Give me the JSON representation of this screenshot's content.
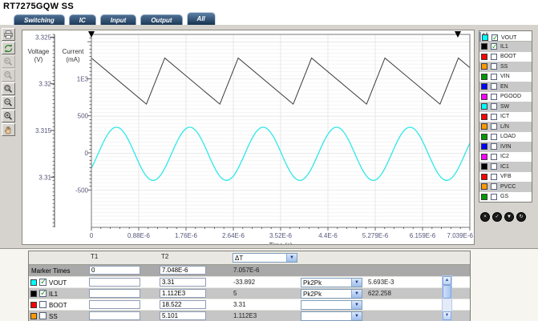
{
  "title": "RT7275GQW SS",
  "tabs": [
    {
      "label": "Switching",
      "active": false
    },
    {
      "label": "IC",
      "active": false
    },
    {
      "label": "Input",
      "active": false
    },
    {
      "label": "Output",
      "active": false
    },
    {
      "label": "All",
      "active": true
    }
  ],
  "toolbar": [
    {
      "name": "print-button",
      "icon": "print-icon",
      "disabled": false
    },
    {
      "name": "refresh-button",
      "icon": "refresh-icon",
      "disabled": false
    },
    {
      "name": "zoom-previous-button",
      "icon": "zoom-previous-icon",
      "disabled": true
    },
    {
      "name": "zoom-undo-button",
      "icon": "zoom-undo-icon",
      "disabled": true
    },
    {
      "name": "zoom-window-button",
      "icon": "zoom-window-icon",
      "disabled": false
    },
    {
      "name": "zoom-out-button",
      "icon": "zoom-out-icon",
      "disabled": false
    },
    {
      "name": "zoom-in-button",
      "icon": "zoom-in-icon",
      "disabled": false
    },
    {
      "name": "pan-button",
      "icon": "pan-hand-icon",
      "disabled": false
    }
  ],
  "legend": {
    "header": "All",
    "items": [
      {
        "label": "VOUT",
        "color": "#00FFFF",
        "checked": true,
        "selected": true
      },
      {
        "label": "IL1",
        "color": "#000000",
        "checked": true,
        "selected": false
      },
      {
        "label": "BOOT",
        "color": "#FF0000",
        "checked": false,
        "selected": false
      },
      {
        "label": "SS",
        "color": "#FF9900",
        "checked": false,
        "selected": false
      },
      {
        "label": "VIN",
        "color": "#009900",
        "checked": false,
        "selected": false
      },
      {
        "label": "EN",
        "color": "#0000FF",
        "checked": false,
        "selected": false
      },
      {
        "label": "PGOOD",
        "color": "#FF00FF",
        "checked": false,
        "selected": false
      },
      {
        "label": "SW",
        "color": "#00FFFF",
        "checked": false,
        "selected": false
      },
      {
        "label": "ICT",
        "color": "#FF0000",
        "checked": false,
        "selected": false
      },
      {
        "label": "L/N",
        "color": "#FF9900",
        "checked": false,
        "selected": false
      },
      {
        "label": "LOAD",
        "color": "#009900",
        "checked": false,
        "selected": false
      },
      {
        "label": "IVIN",
        "color": "#0000FF",
        "checked": false,
        "selected": false
      },
      {
        "label": "IC2",
        "color": "#FF00FF",
        "checked": false,
        "selected": false
      },
      {
        "label": "IC1",
        "color": "#000000",
        "checked": false,
        "selected": false
      },
      {
        "label": "VFB",
        "color": "#FF0000",
        "checked": false,
        "selected": false
      },
      {
        "label": "PVCC",
        "color": "#FF9900",
        "checked": false,
        "selected": false
      },
      {
        "label": "GS",
        "color": "#009900",
        "checked": false,
        "selected": false
      }
    ],
    "buttons": [
      {
        "name": "legend-close-button",
        "icon": "circle-x-icon"
      },
      {
        "name": "legend-check-button",
        "icon": "circle-check-icon"
      },
      {
        "name": "legend-scroll-down-button",
        "icon": "circle-chevron-down-icon"
      },
      {
        "name": "legend-refresh-button",
        "icon": "circle-redo-icon"
      }
    ]
  },
  "table": {
    "header": {
      "t1": "T1",
      "t2": "T2",
      "delta_select": "ΔT"
    },
    "marker_row": {
      "label": "Marker Times",
      "t1": "0",
      "t2": "7.048E-6",
      "delta": "7.057E-6"
    },
    "rows": [
      {
        "name": "VOUT",
        "color": "#00FFFF",
        "checked": true,
        "t1": "",
        "t2": "3.31",
        "delta": "-33.892",
        "func": "Pk2Pk",
        "result": "5.693E-3"
      },
      {
        "name": "IL1",
        "color": "#000000",
        "checked": true,
        "t1": "",
        "t2": "1.112E3",
        "delta": "5",
        "func": "Pk2Pk",
        "result": "622.258"
      },
      {
        "name": "BOOT",
        "color": "#FF0000",
        "checked": false,
        "t1": "",
        "t2": "18.522",
        "delta": "3.31",
        "func": "",
        "result": ""
      },
      {
        "name": "SS",
        "color": "#FF9900",
        "checked": false,
        "t1": "",
        "t2": "5.101",
        "delta": "1.112E3",
        "func": "",
        "result": ""
      }
    ]
  },
  "chart_data": {
    "type": "line",
    "xlabel": "Time (s)",
    "x_tick_labels": [
      "0",
      "0.88E-6",
      "1.76E-6",
      "2.64E-6",
      "3.52E-6",
      "4.4E-6",
      "5.279E-6",
      "6.159E-6",
      "7.039E-6"
    ],
    "x_max_s": 7.039e-06,
    "grid": true,
    "y_axes": [
      {
        "name": "voltage",
        "label_line1": "Voltage",
        "label_line2": "(V)",
        "tick_labels": [
          "3.325",
          "3.32",
          "3.315",
          "3.31"
        ],
        "tick_values": [
          3.325,
          3.32,
          3.315,
          3.31
        ]
      },
      {
        "name": "current",
        "label_line1": "Current",
        "label_line2": "(mA)",
        "tick_labels": [
          "1E3",
          "500",
          "0",
          "-500"
        ],
        "tick_values": [
          1000,
          500,
          0,
          -500
        ]
      }
    ],
    "markers_s": [
      0,
      7.048e-06
    ],
    "series": [
      {
        "name": "IL1",
        "color": "#3C3C3C",
        "axis": "current",
        "waveform": "sawtooth",
        "peak": 1280,
        "trough": 658,
        "period_s": 1.365e-06,
        "fall_fraction": 0.75,
        "phase": "starts_at_peak"
      },
      {
        "name": "VOUT",
        "color": "#2FE8E8",
        "axis": "voltage",
        "waveform": "sine",
        "mean": 3.3125,
        "amplitude": 0.00285,
        "period_s": 1.365e-06,
        "first_trough_s": 1.148e-06
      }
    ]
  }
}
